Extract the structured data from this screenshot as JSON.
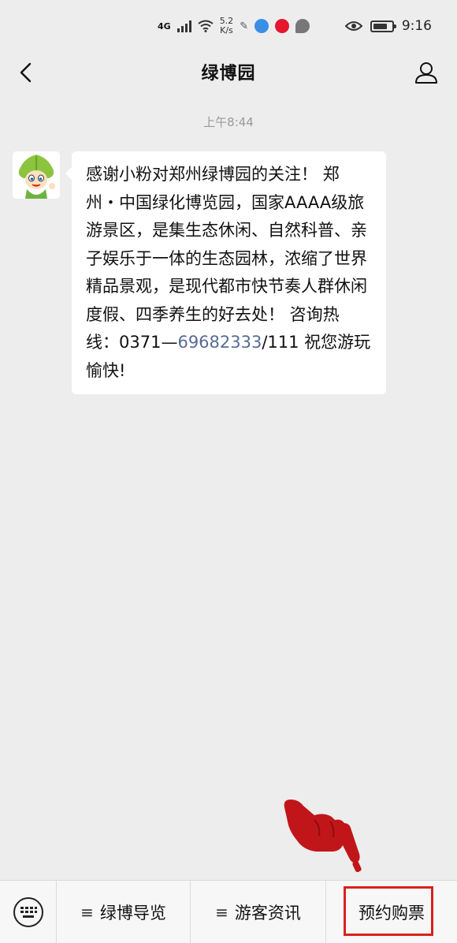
{
  "status_bar": {
    "network": "4G",
    "speed_value": "5.2",
    "speed_unit": "K/s",
    "time": "9:16",
    "icons": [
      "signal-icon",
      "wifi-icon",
      "app-notification-icon",
      "browser-icon",
      "weibo-icon",
      "message-icon",
      "eye-icon",
      "battery-icon"
    ]
  },
  "header": {
    "title": "绿博园",
    "back_icon": "chevron-left-icon",
    "profile_icon": "person-icon"
  },
  "chat": {
    "timestamp": "上午8:44",
    "message_main": "感谢小粉对郑州绿博园的关注！ 郑州・中国绿化博览园，国家AAAA级旅游景区，是集生态休闲、自然科普、亲子娱乐于一体的生态园林，浓缩了世界精品景观，是现代都市快节奏人群休闲度假、四季养生的好去处！ 咨询热线：0371—",
    "message_phone": "69682333",
    "message_tail": "/111 祝您游玩愉快!"
  },
  "menu": {
    "keyboard_icon": "keyboard-icon",
    "items": [
      {
        "label": "绿博导览",
        "icon": "≡"
      },
      {
        "label": "游客资讯",
        "icon": "≡"
      },
      {
        "label": "预约购票",
        "icon": ""
      }
    ]
  },
  "annotation": {
    "highlight_color": "#d8221c"
  }
}
